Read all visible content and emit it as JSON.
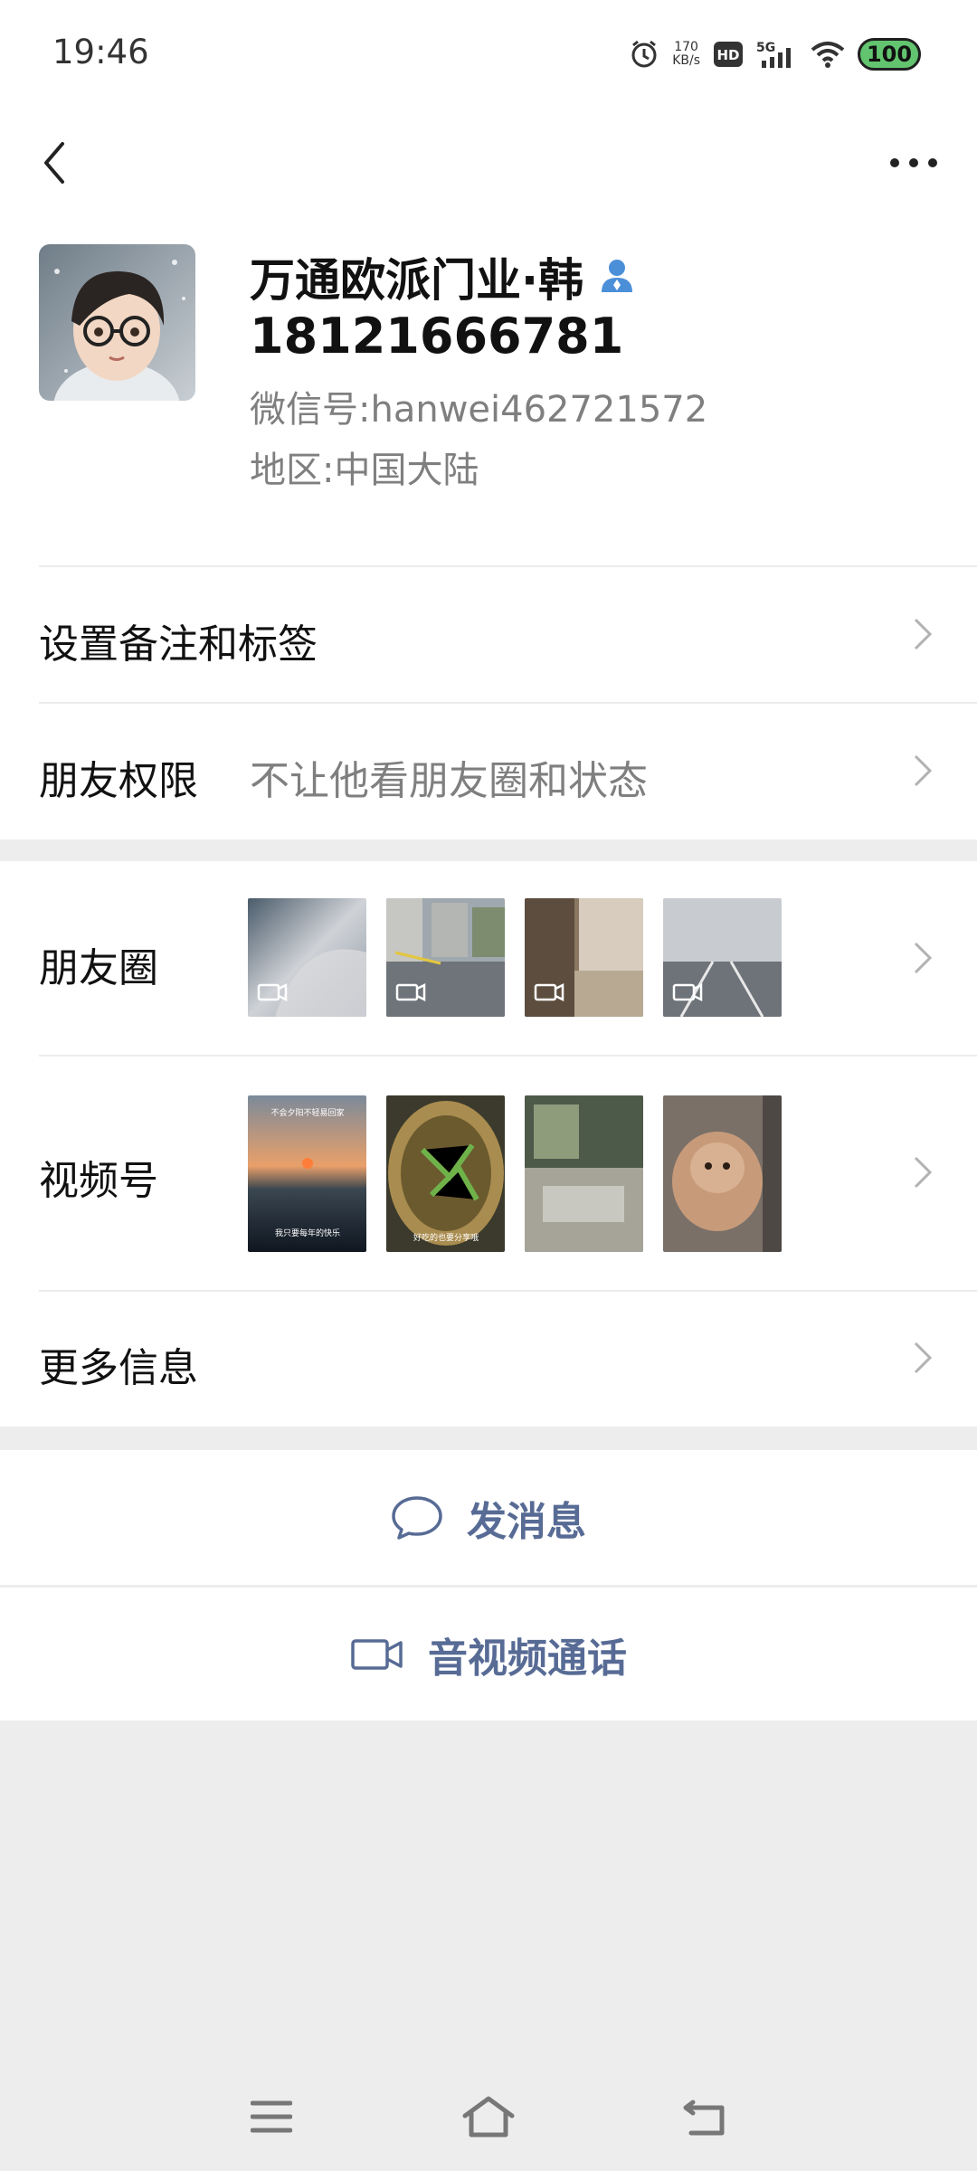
{
  "status_bar": {
    "time": "19:46",
    "network_speed": "170",
    "network_speed_unit": "KB/s",
    "hd_label": "HD",
    "signal_label": "5G",
    "battery": "100",
    "icons": [
      "alarm-icon",
      "hd-icon",
      "signal-5g-icon",
      "wifi-icon",
      "battery-icon"
    ]
  },
  "nav": {
    "back_icon": "chevron-left-icon",
    "more_icon": "more-dots-icon"
  },
  "profile": {
    "name": "万通欧派门业·韩",
    "nickname": "18121666781",
    "wechat_id_label": "微信号:",
    "wechat_id": "hanwei462721572",
    "region_label": "地区:",
    "region": "中国大陆",
    "gender_icon": "male-person-icon",
    "accent": "#4c8fd9"
  },
  "rows": {
    "remark": {
      "label": "设置备注和标签"
    },
    "permissions": {
      "label": "朋友权限",
      "value": "不让他看朋友圈和状态"
    },
    "moments": {
      "label": "朋友圈"
    },
    "channels": {
      "label": "视频号"
    },
    "more_info": {
      "label": "更多信息"
    }
  },
  "moments_thumbs": [
    {
      "kind": "video",
      "colors": [
        "#c9cbd0",
        "#8e98a6"
      ]
    },
    {
      "kind": "video",
      "colors": [
        "#a9b1b8",
        "#6d7580"
      ]
    },
    {
      "kind": "video",
      "colors": [
        "#c7b8a4",
        "#6e5d4a"
      ]
    },
    {
      "kind": "video",
      "colors": [
        "#cbcfd3",
        "#8f979e"
      ]
    }
  ],
  "channels_thumbs": [
    {
      "caption_top": "不会夕阳不轻易回家",
      "caption_bottom": "我只要每年的快乐",
      "colors": [
        "#7b8a9a",
        "#1d2530"
      ]
    },
    {
      "caption_bottom": "好吃的也要分享哦",
      "colors": [
        "#5a4a2b",
        "#b79a52"
      ]
    },
    {
      "colors": [
        "#5e5f58",
        "#a9a79c"
      ]
    },
    {
      "colors": [
        "#c0a28a",
        "#6e5a4a"
      ]
    }
  ],
  "actions": {
    "message": "发消息",
    "call": "音视频通话"
  },
  "colors": {
    "link": "#576b95",
    "gray_text": "#7f7f7f",
    "background": "#ededed"
  },
  "system_nav": [
    "menu-icon",
    "home-icon",
    "back-icon"
  ]
}
